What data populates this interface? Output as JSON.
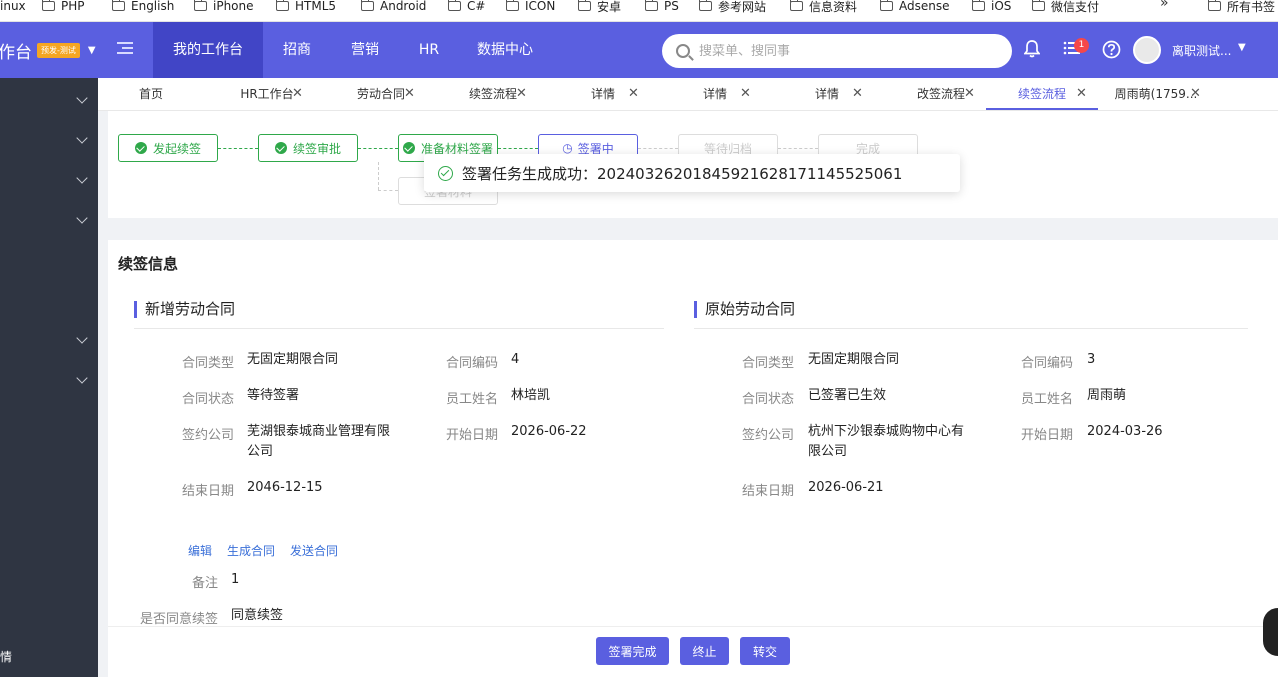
{
  "bookmarks": [
    "inux",
    "PHP",
    "English",
    "iPhone",
    "HTML5",
    "Android",
    "C#",
    "ICON",
    "安卓",
    "PS",
    "参考网站",
    "信息资料",
    "Adsense",
    "iOS",
    "微信支付",
    "»",
    "所有书签"
  ],
  "header": {
    "brand": "作台",
    "env_badge": "预发-测试",
    "nav": [
      "我的工作台",
      "招商",
      "营销",
      "HR",
      "数据中心"
    ],
    "search_placeholder": "搜菜单、搜同事",
    "notification_count": "1",
    "user_name": "离职测试..."
  },
  "sidebar": {
    "bottom_label": "情"
  },
  "tabs": [
    {
      "label": "首页",
      "closable": false
    },
    {
      "label": "HR工作台",
      "closable": true
    },
    {
      "label": "劳动合同",
      "closable": true
    },
    {
      "label": "续签流程",
      "closable": true
    },
    {
      "label": "详情",
      "closable": true
    },
    {
      "label": "详情",
      "closable": true
    },
    {
      "label": "详情",
      "closable": true
    },
    {
      "label": "改签流程",
      "closable": true
    },
    {
      "label": "续签流程",
      "closable": true,
      "active": true
    },
    {
      "label": "周雨萌(1759...",
      "closable": true
    }
  ],
  "flow": {
    "steps": [
      "发起续签",
      "续签审批",
      "准备材料签署",
      "签署中",
      "等待归档",
      "完成"
    ],
    "branch_step": "签署材料"
  },
  "toast": {
    "message": "签署任务生成成功：20240326201845921628171145525061"
  },
  "renewal": {
    "title": "续签信息",
    "new_contract": {
      "title": "新增劳动合同",
      "type_label": "合同类型",
      "type": "无固定期限合同",
      "code_label": "合同编码",
      "code": "4",
      "status_label": "合同状态",
      "status": "等待签署",
      "name_label": "员工姓名",
      "name": "林培凯",
      "company_label": "签约公司",
      "company": "芜湖银泰城商业管理有限公司",
      "start_label": "开始日期",
      "start": "2026-06-22",
      "end_label": "结束日期",
      "end": "2046-12-15"
    },
    "orig_contract": {
      "title": "原始劳动合同",
      "type_label": "合同类型",
      "type": "无固定期限合同",
      "code_label": "合同编码",
      "code": "3",
      "status_label": "合同状态",
      "status": "已签署已生效",
      "name_label": "员工姓名",
      "name": "周雨萌",
      "company_label": "签约公司",
      "company": "杭州下沙银泰城购物中心有限公司",
      "start_label": "开始日期",
      "start": "2024-03-26",
      "end_label": "结束日期",
      "end": "2026-06-21"
    },
    "actions": [
      "编辑",
      "生成合同",
      "发送合同"
    ],
    "remark_label": "备注",
    "remark": "1",
    "agree_label": "是否同意续签",
    "agree": "同意续签"
  },
  "footer_buttons": [
    "签署完成",
    "终止",
    "转交"
  ],
  "colors": {
    "primary": "#5a5fe0",
    "success": "#2fa84a",
    "sidebar": "#2f3542"
  }
}
